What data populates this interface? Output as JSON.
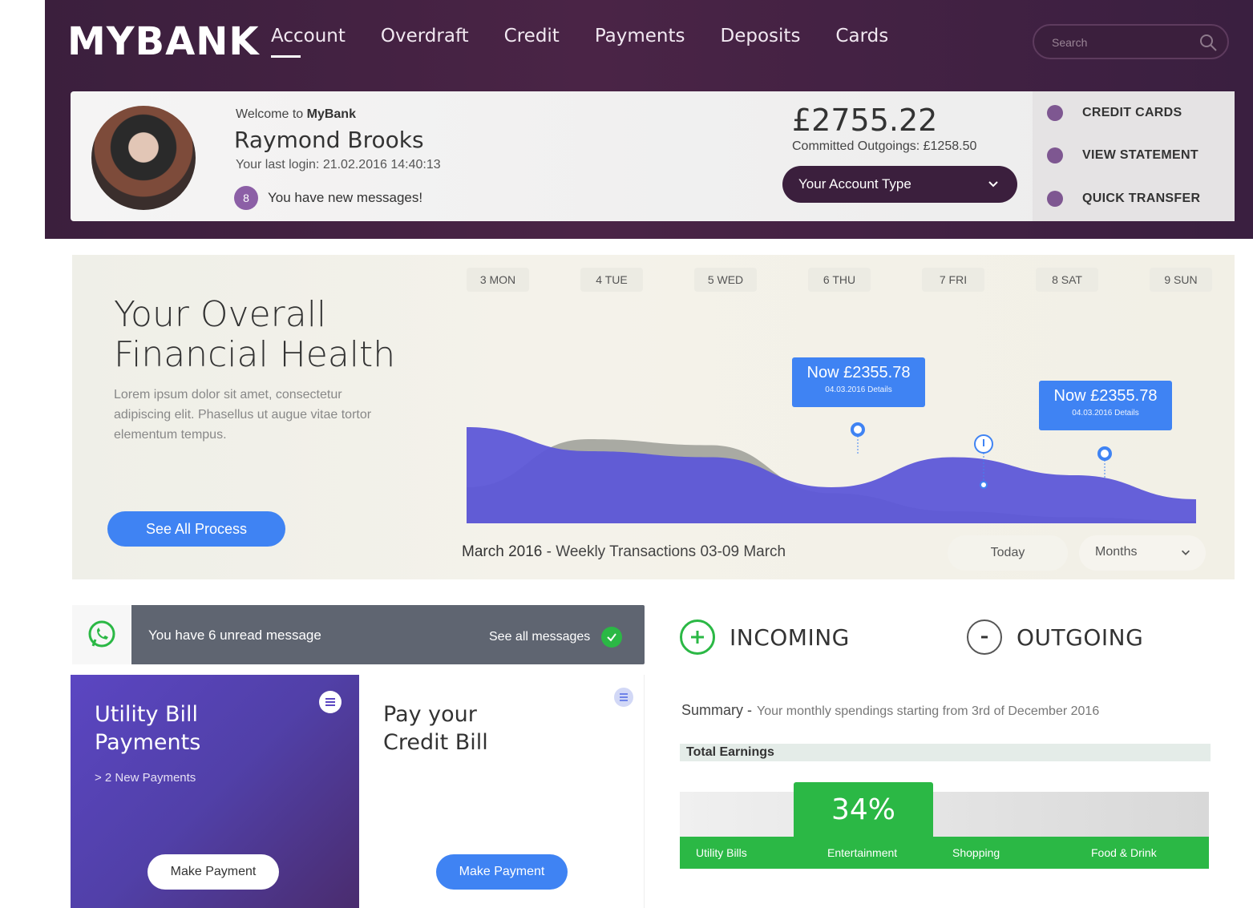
{
  "header": {
    "logo": "MYBANK",
    "nav": [
      "Account",
      "Overdraft",
      "Credit",
      "Payments",
      "Deposits",
      "Cards"
    ],
    "search_placeholder": "Search"
  },
  "profile": {
    "welcome_prefix": "Welcome to ",
    "welcome_brand": "MyBank",
    "name": "Raymond Brooks",
    "last_login": "Your last login: 21.02.2016 14:40:13",
    "message_count": "8",
    "message_text": "You have new messages!",
    "balance": "£2755.22",
    "committed": "Committed Outgoings: £1258.50",
    "account_type": "Your Account Type",
    "quick_links": [
      "CREDIT CARDS",
      "VIEW STATEMENT",
      "QUICK TRANSFER"
    ]
  },
  "health": {
    "title_line1": "Your Overall",
    "title_line2": "Financial Health",
    "text": "Lorem ipsum dolor sit amet, consectetur adipiscing elit. Phasellus ut augue vitae tortor elementum tempus.",
    "button": "See All Process",
    "caption_bold": "March 2016",
    "caption_rest": " - Weekly Transactions 03-09 March",
    "today": "Today",
    "months": "Months"
  },
  "chart_data": {
    "type": "area",
    "categories": [
      "3 MON",
      "4 TUE",
      "5 WED",
      "6 THU",
      "7 FRI",
      "8 SAT",
      "9 SUN"
    ],
    "series": [
      {
        "values": [
          0.8,
          0.6,
          0.55,
          0.3,
          0.55,
          0.4,
          0.2
        ],
        "color": "#5d57d8"
      },
      {
        "values": [
          0.3,
          0.7,
          0.65,
          0.25,
          0.1,
          0.05,
          0.02
        ],
        "color": "#a9aaa3"
      }
    ],
    "tooltips": [
      {
        "title": "Now £2355.78",
        "sub": "04.03.2016 Details"
      },
      {
        "title": "Now £2355.78",
        "sub": "04.03.2016 Details"
      }
    ]
  },
  "messages": {
    "unread": "You have 6 unread message",
    "see_all": "See all messages"
  },
  "utility": {
    "title1": "Utility Bill",
    "title2": "Payments",
    "new": "> 2 New Payments",
    "button": "Make Payment"
  },
  "credit": {
    "title1": "Pay your",
    "title2": "Credit Bill",
    "button": "Make Payment"
  },
  "flows": {
    "incoming": "INCOMING",
    "outgoing": "OUTGOING",
    "summary_label": "Summary -",
    "summary_text": "Your monthly spendings starting from 3rd of December 2016",
    "total_earnings": "Total Earnings",
    "percent": "34%",
    "categories": [
      "Utility Bills",
      "Entertainment",
      "Shopping",
      "Food & Drink"
    ]
  },
  "colors": {
    "brand": "#3b1f3d",
    "accent_blue": "#3f83f3",
    "green": "#2bb845",
    "purple": "#7e5791"
  }
}
